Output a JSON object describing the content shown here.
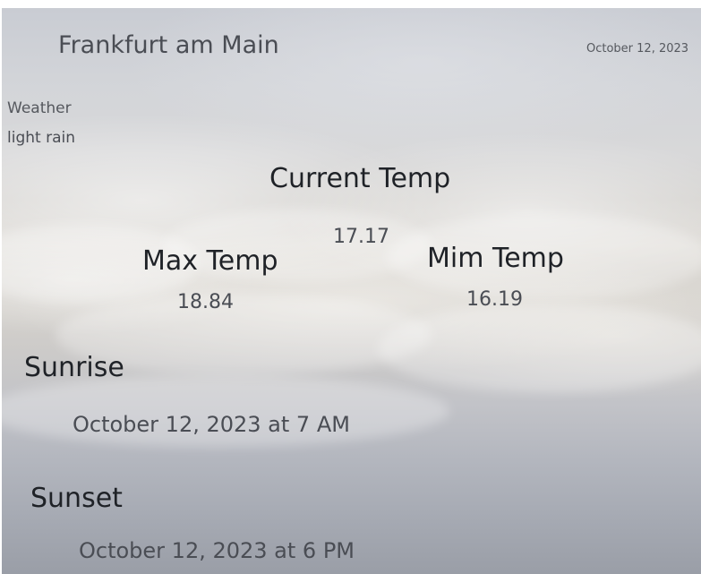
{
  "header": {
    "city": "Frankfurt am Main",
    "date": "October 12, 2023"
  },
  "weather": {
    "label": "Weather",
    "description": "light rain"
  },
  "temperature": {
    "current_label": "Current Temp",
    "current_value": "17.17",
    "max_label": "Max Temp",
    "max_value": "18.84",
    "min_label": "Mim Temp",
    "min_value": "16.19"
  },
  "sun": {
    "sunrise_label": "Sunrise",
    "sunrise_value": "October 12, 2023 at 7 AM",
    "sunset_label": "Sunset",
    "sunset_value": "October 12, 2023 at 6 PM"
  },
  "colors": {
    "heading_text": "#1f2227",
    "value_text": "#4a4d54",
    "sky_top": "#c9ccd3",
    "sky_bottom": "#9a9ea7"
  }
}
